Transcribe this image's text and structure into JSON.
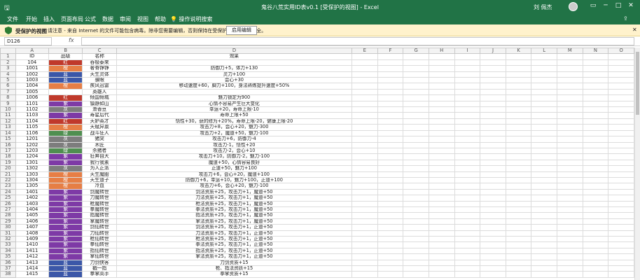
{
  "window": {
    "title": "鬼谷八荒实用ID表v0.1 [受保护的视图] - Excel",
    "user": "刘 佩杰",
    "quick_access_icon": "save-icon"
  },
  "ribbon": {
    "tabs": [
      "文件",
      "开始",
      "插入",
      "页面布局",
      "公式",
      "数据",
      "审阅",
      "视图",
      "帮助"
    ],
    "tell_me": "操作说明搜索"
  },
  "protected_view": {
    "title": "受保护的视图",
    "message": "请注意 - 来自 Internet 的文件可能包含病毒。除非您需要编辑，否则保持在受保护视图中比较安全。",
    "enable_button": "启用编辑"
  },
  "formula_bar": {
    "name_box": "D126",
    "fx": "fx",
    "formula": ""
  },
  "colors": {
    "ribbon_green": "#217346",
    "quality": {
      "红": "#c0392b",
      "橙": "#e67e45",
      "蓝": "#3b57a8",
      "紫": "#7e3aa6",
      "绿": "#4f8f50",
      "灰": "#7d7d7d"
    }
  },
  "columns": [
    "A",
    "B",
    "C",
    "D",
    "E",
    "F",
    "G",
    "H",
    "I",
    "J",
    "K",
    "L",
    "M",
    "N",
    "O"
  ],
  "rows": [
    {
      "n": "1",
      "a": "ID",
      "b": "品级",
      "c": "名称",
      "d": "效果",
      "q": ""
    },
    {
      "n": "2",
      "a": "104",
      "b": "红",
      "c": "吞极泰来",
      "d": "",
      "q": "红"
    },
    {
      "n": "3",
      "a": "1001",
      "b": "橙",
      "c": "奢脊铮铮",
      "d": "防御力+5，体力+130",
      "q": "橙"
    },
    {
      "n": "4",
      "a": "1002",
      "b": "蓝",
      "c": "天生灵体",
      "d": "灵力+100",
      "q": "蓝"
    },
    {
      "n": "5",
      "a": "1003",
      "b": "蓝",
      "c": "骥眼",
      "d": "会心+30",
      "q": "蓝"
    },
    {
      "n": "6",
      "a": "1004",
      "b": "橙",
      "c": "疾风迅雷",
      "d": "移动速度+60，脚力+100，身法熟练提升速度+50%",
      "q": "橙"
    },
    {
      "n": "7",
      "a": "1005",
      "b": "",
      "c": "英雄人",
      "d": "",
      "q": ""
    },
    {
      "n": "8",
      "a": "1006",
      "b": "红",
      "c": "倾国倾城",
      "d": "魅力锁定为900",
      "q": "红"
    },
    {
      "n": "9",
      "a": "1101",
      "b": "紫",
      "c": "镇静如山",
      "d": "心情不容易产生巨大变化",
      "q": "紫"
    },
    {
      "n": "10",
      "a": "1102",
      "b": "灰",
      "c": "萧香豆",
      "d": "幸运+20，寿命上限-10",
      "q": "灰"
    },
    {
      "n": "11",
      "a": "1103",
      "b": "紫",
      "c": "寿星后代",
      "d": "寿命上限+50",
      "q": "紫"
    },
    {
      "n": "12",
      "a": "1104",
      "b": "红",
      "c": "天妒英才",
      "d": "悟性+30，获的修为+20%，寿命上限-20，健康上限-20",
      "q": "红"
    },
    {
      "n": "13",
      "a": "1105",
      "b": "橙",
      "c": "天赋异禀",
      "d": "攻击力+8，会心+20，魅力-300",
      "q": "橙"
    },
    {
      "n": "14",
      "a": "1106",
      "b": "绿",
      "c": "战斗狂人",
      "d": "攻击力+2，魔道+50，魅力-100",
      "q": "绿"
    },
    {
      "n": "15",
      "a": "1201",
      "b": "灰",
      "c": "猪突",
      "d": "攻击力+6，防御力-4",
      "q": "灰"
    },
    {
      "n": "16",
      "a": "1202",
      "b": "灰",
      "c": "木匠",
      "d": "攻击力-1，悟性+20",
      "q": "灰"
    },
    {
      "n": "17",
      "a": "1203",
      "b": "绿",
      "c": "杀猪者",
      "d": "攻击力-2，会心+10",
      "q": "绿"
    },
    {
      "n": "18",
      "a": "1204",
      "b": "紫",
      "c": "狂奔自大",
      "d": "攻击力+10，防御力-2，魅力-100",
      "q": "紫"
    },
    {
      "n": "19",
      "a": "1301",
      "b": "紫",
      "c": "我行我素",
      "d": "魔道+50，心情容易良好",
      "q": "紫"
    },
    {
      "n": "20",
      "a": "1302",
      "b": "灰",
      "c": "为人正派",
      "d": "正道+50，魅力+100",
      "q": "灰"
    },
    {
      "n": "21",
      "a": "1303",
      "b": "橙",
      "c": "天生魔胎",
      "d": "攻击力+6，会心+20，魔道+100",
      "q": "橙"
    },
    {
      "n": "22",
      "a": "1304",
      "b": "橙",
      "c": "天生道子",
      "d": "防御力+6，幸运+10，魅力+100，正道+100",
      "q": "橙"
    },
    {
      "n": "23",
      "a": "1305",
      "b": "橙",
      "c": "冷血",
      "d": "攻击力+6，会心+20，魅力-100",
      "q": "橙"
    },
    {
      "n": "24",
      "a": "1401",
      "b": "紫",
      "c": "剑魔转世",
      "d": "剑法资质+25，攻击力+1，魔道+50",
      "q": "紫"
    },
    {
      "n": "25",
      "a": "1402",
      "b": "紫",
      "c": "刀魔转世",
      "d": "刀法资质+25，攻击力+1，魔道+50",
      "q": "紫"
    },
    {
      "n": "26",
      "a": "1403",
      "b": "紫",
      "c": "枪魔转世",
      "d": "枪法资质+25，攻击力+1，魔道+50",
      "q": "紫"
    },
    {
      "n": "27",
      "a": "1404",
      "b": "紫",
      "c": "拳魔转世",
      "d": "拳法资质+25，攻击力+1，魔道+50",
      "q": "紫"
    },
    {
      "n": "28",
      "a": "1405",
      "b": "紫",
      "c": "指魔转世",
      "d": "指法资质+25，攻击力+1，魔道+50",
      "q": "紫"
    },
    {
      "n": "29",
      "a": "1406",
      "b": "紫",
      "c": "掌魔转世",
      "d": "掌法资质+25，攻击力+1，魔道+50",
      "q": "紫"
    },
    {
      "n": "30",
      "a": "1407",
      "b": "紫",
      "c": "剑仙转世",
      "d": "剑法资质+25，攻击力+1，正道+50",
      "q": "紫"
    },
    {
      "n": "31",
      "a": "1408",
      "b": "紫",
      "c": "刀仙转世",
      "d": "刀法资质+25，攻击力+1，正道+50",
      "q": "紫"
    },
    {
      "n": "32",
      "a": "1409",
      "b": "紫",
      "c": "枪仙转世",
      "d": "枪法资质+25，攻击力+1，正道+50",
      "q": "紫"
    },
    {
      "n": "33",
      "a": "1410",
      "b": "紫",
      "c": "拳仙转世",
      "d": "拳法资质+25，攻击力+1，正道+50",
      "q": "紫"
    },
    {
      "n": "34",
      "a": "1411",
      "b": "紫",
      "c": "指仙转世",
      "d": "指法资质+25，攻击力+1，正道+50",
      "q": "紫"
    },
    {
      "n": "35",
      "a": "1412",
      "b": "紫",
      "c": "掌仙转世",
      "d": "掌法资质+25，攻击力+1，正道+50",
      "q": "紫"
    },
    {
      "n": "36",
      "a": "1413",
      "b": "蓝",
      "c": "刀剑侠客",
      "d": "刀剑资质+15",
      "q": "蓝"
    },
    {
      "n": "37",
      "a": "1414",
      "b": "蓝",
      "c": "戳一指",
      "d": "枪、指法资质+15",
      "q": "蓝"
    },
    {
      "n": "38",
      "a": "1415",
      "b": "蓝",
      "c": "拳掌高手",
      "d": "拳掌资质+15",
      "q": "蓝"
    }
  ]
}
